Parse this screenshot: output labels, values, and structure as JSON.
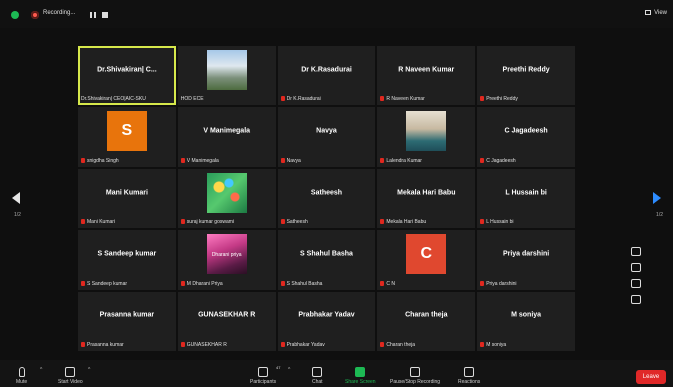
{
  "recording": {
    "label": "Recording..."
  },
  "view_label": "View",
  "pagination": {
    "current": "1/2"
  },
  "tiles": [
    {
      "name": "Dr.Shivakiran| C...",
      "label": "Dr.Shivakiran| CEO|AIC-SKU",
      "muted": false,
      "active": true
    },
    {
      "name": "",
      "label": "HOD ECE",
      "muted": false,
      "photo": "building"
    },
    {
      "name": "Dr K.Rasadurai",
      "label": "Dr K.Rasadurai",
      "muted": true
    },
    {
      "name": "R Naveen Kumar",
      "label": "R Naveen Kumar",
      "muted": true
    },
    {
      "name": "Preethi Reddy",
      "label": "Preethi Reddy",
      "muted": true
    },
    {
      "name": "",
      "label": "snigdha Singh",
      "muted": true,
      "letter": "S",
      "letter_color": "#e8740c"
    },
    {
      "name": "V Manimegala",
      "label": "V Manimegala",
      "muted": true
    },
    {
      "name": "Navya",
      "label": "Navya",
      "muted": true
    },
    {
      "name": "",
      "label": "Lalendra Kumar",
      "muted": true,
      "photo": "person"
    },
    {
      "name": "C Jagadeesh",
      "label": "C Jagadeesh",
      "muted": true
    },
    {
      "name": "Mani Kumari",
      "label": "Mani Kumari",
      "muted": true
    },
    {
      "name": "",
      "label": "suraj kumar goswami",
      "muted": true,
      "photo": "tiles"
    },
    {
      "name": "Satheesh",
      "label": "Satheesh",
      "muted": true
    },
    {
      "name": "Mekala Hari Babu",
      "label": "Mekala Hari Babu",
      "muted": true
    },
    {
      "name": "L Hussain bi",
      "label": "L Hussain bi",
      "muted": true
    },
    {
      "name": "S Sandeep kumar",
      "label": "S Sandeep kumar",
      "muted": true
    },
    {
      "name": "",
      "label": "M Dharani Priya",
      "muted": true,
      "photo": "pink",
      "caption": "Dharani priya"
    },
    {
      "name": "S Shahul Basha",
      "label": "S Shahul Basha",
      "muted": true
    },
    {
      "name": "",
      "label": "C N",
      "muted": true,
      "letter": "C",
      "letter_color": "#e0482f"
    },
    {
      "name": "Priya darshini",
      "label": "Priya darshini",
      "muted": true
    },
    {
      "name": "Prasanna kumar",
      "label": "Prasanna kumar",
      "muted": true
    },
    {
      "name": "GUNASEKHAR R",
      "label": "GUNASEKHAR R",
      "muted": true
    },
    {
      "name": "Prabhakar Yadav",
      "label": "Prabhakar Yadav",
      "muted": true
    },
    {
      "name": "Charan theja",
      "label": "Charan theja",
      "muted": true
    },
    {
      "name": "M soniya",
      "label": "M soniya",
      "muted": true
    }
  ],
  "toolbar": {
    "mute": "Mute",
    "start_video": "Start Video",
    "participants": "Participants",
    "participants_count": "47",
    "chat": "Chat",
    "share_screen": "Share Screen",
    "pause_stop_recording": "Pause/Stop Recording",
    "reactions": "Reactions",
    "leave": "Leave"
  }
}
